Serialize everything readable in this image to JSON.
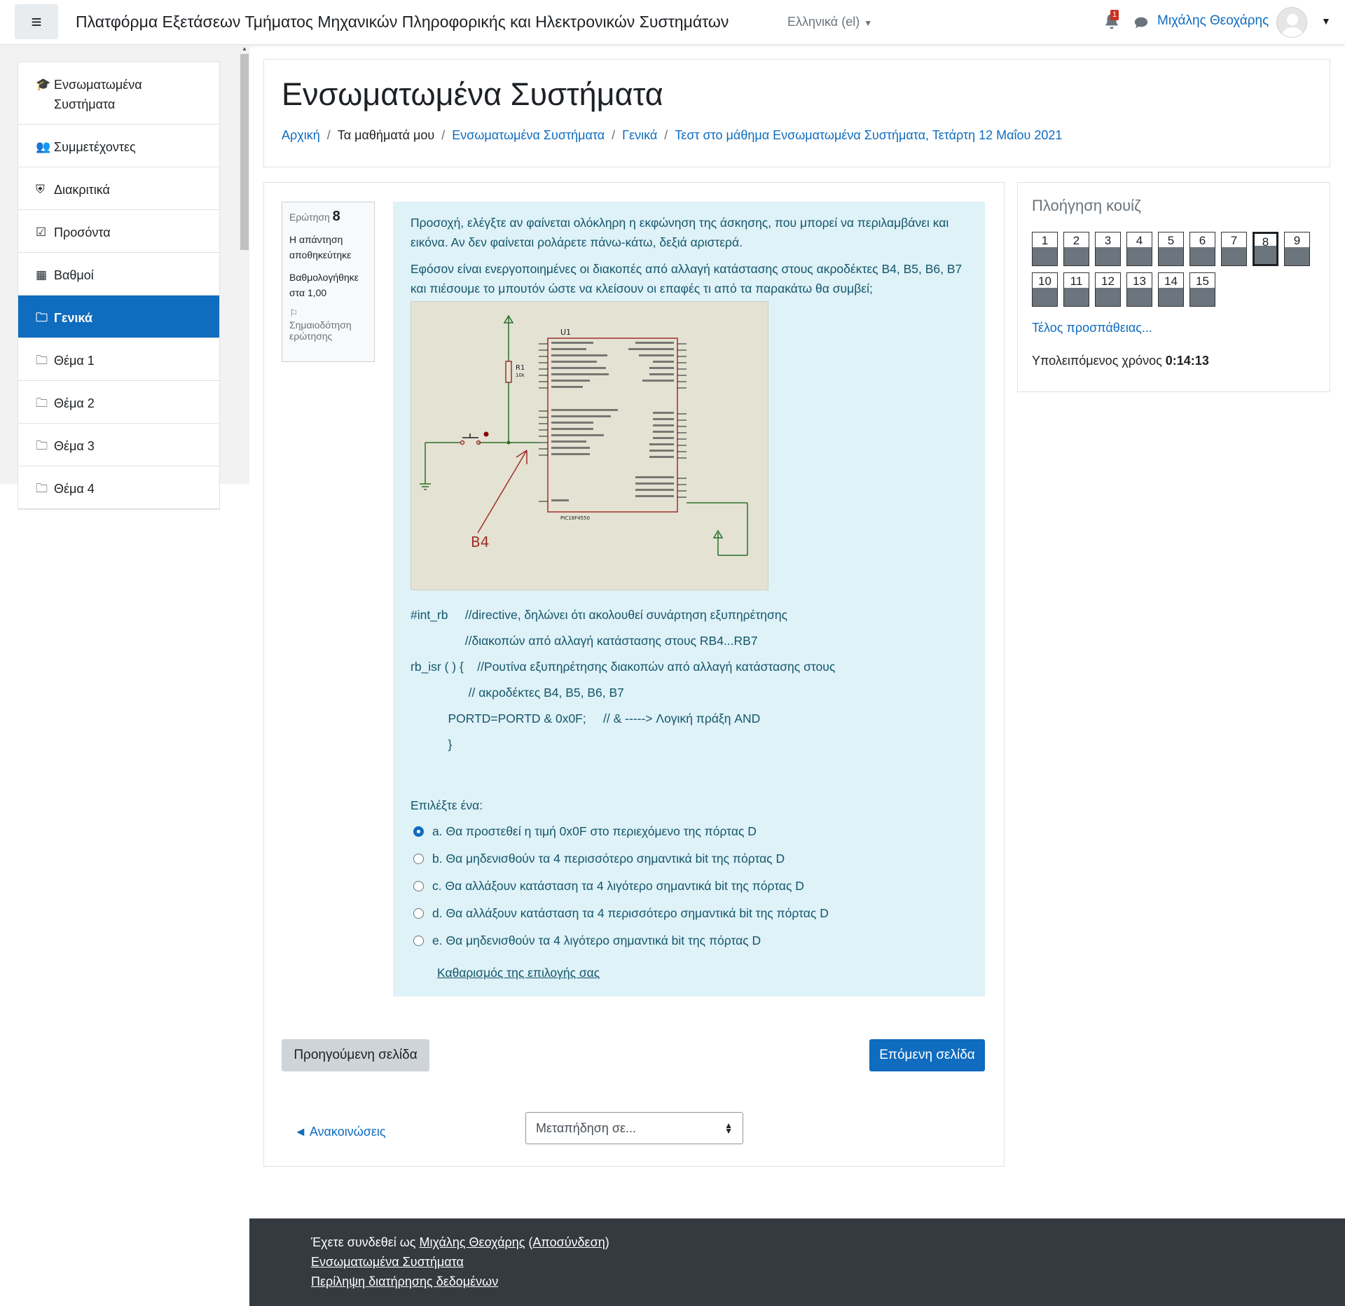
{
  "navbar": {
    "toggle_icon": "hamburger-icon",
    "site_name": "Πλατφόρμα Εξετάσεων Τμήματος Μηχανικών Πληροφορικής και Ηλεκτρονικών Συστημάτων",
    "language": "Ελληνικά (el)",
    "notification_count": "1",
    "user_name": "Μιχάλης Θεοχάρης"
  },
  "sidebar": {
    "items": [
      {
        "icon": "graduation-cap-icon",
        "label": "Ενσωματωμένα Συστήματα",
        "active": false
      },
      {
        "icon": "users-icon",
        "label": "Συμμετέχοντες",
        "active": false
      },
      {
        "icon": "shield-icon",
        "label": "Διακριτικά",
        "active": false
      },
      {
        "icon": "checkbox-icon",
        "label": "Προσόντα",
        "active": false
      },
      {
        "icon": "table-icon",
        "label": "Βαθμοί",
        "active": false
      },
      {
        "icon": "folder-icon",
        "label": "Γενικά",
        "active": true
      },
      {
        "icon": "folder-icon",
        "label": "Θέμα 1",
        "active": false
      },
      {
        "icon": "folder-icon",
        "label": "Θέμα 2",
        "active": false
      },
      {
        "icon": "folder-icon",
        "label": "Θέμα 3",
        "active": false
      },
      {
        "icon": "folder-icon",
        "label": "Θέμα 4",
        "active": false
      }
    ]
  },
  "header": {
    "title": "Ενσωματωμένα Συστήματα",
    "breadcrumb": [
      {
        "label": "Αρχική",
        "link": true
      },
      {
        "label": "Τα μαθήματά μου",
        "link": false
      },
      {
        "label": "Ενσωματωμένα Συστήματα",
        "link": true
      },
      {
        "label": "Γενικά",
        "link": true
      },
      {
        "label": "Τεστ στο μάθημα Ενσωματωμένα Συστήματα, Τετάρτη 12 Μαΐου 2021",
        "link": true
      }
    ]
  },
  "question": {
    "label": "Ερώτηση",
    "number": "8",
    "state": "Η απάντηση αποθηκεύτηκε",
    "grade": "Βαθμολογήθηκε στα 1,00",
    "flag": "Σημαιοδότηση ερώτησης",
    "text_1": "Προσοχή, ελέγξτε αν φαίνεται ολόκληρη η εκφώνηση της άσκησης, που μπορεί να περιλαμβάνει και εικόνα. Αν δεν φαίνεται ρολάρετε πάνω-κάτω, δεξιά αριστερά.",
    "text_2": "Εφόσον είναι ενεργοποιημένες οι διακοπές από αλλαγή κατάστασης στους ακροδέκτες B4, B5, B6, B7 και πιέσουμε το μπουτόν ώστε να κλείσουν οι επαφές τι από τα παρακάτω θα συμβεί;",
    "diagram": {
      "chip_label": "U1",
      "chip_part": "PIC18F4550",
      "resistor": "R1",
      "resistor_value": "10k",
      "pin_label": "B4"
    },
    "code": "#int_rb     //directive, δηλώνει ότι ακολουθεί συνάρτηση εξυπηρέτησης\n                //διακοπών από αλλαγή κατάστασης στους RB4...RB7\nrb_isr ( ) {    //Ρουτίνα εξυπηρέτησης διακοπών από αλλαγή κατάστασης στους\n                 // ακροδέκτες B4, B5, B6, B7\n           PORTD=PORTD & 0x0F;     // & -----> Λογική πράξη AND\n           }",
    "prompt": "Επιλέξτε ένα:",
    "answers": [
      {
        "label": "a. Θα προστεθεί η τιμή 0x0F στο περιεχόμενο της πόρτας D",
        "checked": true
      },
      {
        "label": "b. Θα μηδενισθούν τα 4 περισσότερο σημαντικά bit της πόρτας D",
        "checked": false
      },
      {
        "label": "c. Θα αλλάξουν κατάσταση τα 4 λιγότερο σημαντικά bit της πόρτας D",
        "checked": false
      },
      {
        "label": "d. Θα αλλάξουν κατάσταση τα 4 περισσότερο σημαντικά bit της πόρτας D",
        "checked": false
      },
      {
        "label": "e. Θα μηδενισθούν τα 4 λιγότερο σημαντικά bit της πόρτας D",
        "checked": false
      }
    ],
    "clear_choice": "Καθαρισμός της επιλογής σας"
  },
  "nav_buttons": {
    "prev": "Προηγούμενη σελίδα",
    "next": "Επόμενη σελίδα",
    "prev_activity": "◄ Ανακοινώσεις",
    "jump_placeholder": "Μεταπήδηση σε..."
  },
  "quiz_nav": {
    "title": "Πλοήγηση κουίζ",
    "questions": [
      "1",
      "2",
      "3",
      "4",
      "5",
      "6",
      "7",
      "8",
      "9",
      "10",
      "11",
      "12",
      "13",
      "14",
      "15"
    ],
    "current": "8",
    "finish": "Τέλος προσπάθειας...",
    "timer_label": "Υπολειπόμενος χρόνος",
    "timer_value": "0:14:13"
  },
  "footer": {
    "logged_in_prefix": "Έχετε συνδεθεί ως",
    "user": "Μιχάλης Θεοχάρης",
    "logout": "Αποσύνδεση",
    "course": "Ενσωματωμένα Συστήματα",
    "data_summary": "Περίληψη διατήρησης δεδομένων"
  }
}
